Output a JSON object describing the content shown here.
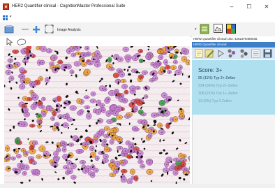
{
  "window": {
    "title": "HER2 Quantifier clinical - CognitionMaster Professional Suite",
    "minimize_glyph": "–",
    "maximize_glyph": "☐",
    "close_glyph": "✕"
  },
  "menu": {
    "dropdown_glyph": "▾"
  },
  "toolbar": {
    "image_analysis_label": "Image Analysis",
    "dropdown_glyph": "▾"
  },
  "right_panel": {
    "title": "HER2 Quantifier clinical UID: 4262378480035",
    "header": "HER2 Quantifier clinical",
    "score": "Score: 3+",
    "results": [
      "55 (11%) Typ 3+ Zellen",
      "334 (66%) Typ 2+ Zellen",
      "106 (21%) Typ 1+ Zellen",
      "13 (3%) Typ 0 Zellen"
    ]
  },
  "colors": {
    "accent": "#3d7ec9",
    "results_bg": "#aee0ef",
    "cell_3plus": "#d93a2a",
    "cell_2plus": "#f0a12a",
    "cell_1plus": "#c77dd1",
    "cell_0": "#2f9b3a",
    "nuclei": "#111111"
  },
  "icons": [
    "app-icon",
    "menu-grid-icon",
    "blue-slide-icon",
    "minus-icon",
    "plus-icon",
    "fit-screen-icon",
    "slide-cabinet-icon",
    "image-frame-icon",
    "overlay-icon",
    "pointer-icon",
    "lasso-icon",
    "notes-icon",
    "edit-icon",
    "play-icon",
    "cells-icon",
    "cells-alt-icon",
    "list-icon",
    "save-icon"
  ]
}
